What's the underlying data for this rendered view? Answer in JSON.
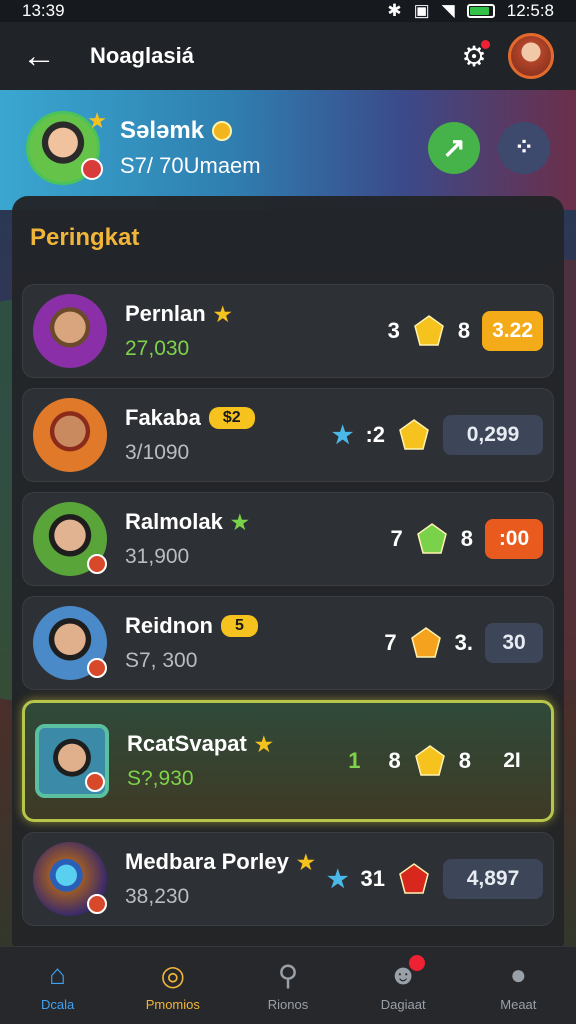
{
  "status": {
    "time": "13:39",
    "right_time": "12:5:8"
  },
  "app_bar": {
    "title": "Noaglasiá"
  },
  "profile": {
    "name": "Sələmk",
    "score": "S7/ 70Umaem"
  },
  "panel": {
    "title": "Peringkat"
  },
  "players": [
    {
      "name": "Pernlan",
      "score": "27,030",
      "left_num": "3",
      "right_num": "8",
      "value": "3.22",
      "gem_color": "#f5c21e",
      "val_style": "yellow",
      "score_style": "green",
      "tag": ""
    },
    {
      "name": "Fakaba",
      "score": "3/1090",
      "left_num": ":2",
      "right_num": "",
      "value": "0,299",
      "gem_color": "#f5c21e",
      "val_style": "slate",
      "score_style": "",
      "tag": "$2"
    },
    {
      "name": "Ralmolak",
      "score": "31,900",
      "left_num": "7",
      "right_num": "8",
      "value": ":00",
      "gem_color": "#7ad24a",
      "val_style": "orange",
      "score_style": "",
      "tag": ""
    },
    {
      "name": "Reidnon",
      "score": "S7, 300",
      "left_num": "7",
      "right_num": "3.",
      "value": "30",
      "gem_color": "#f5a21e",
      "val_style": "dark",
      "score_style": "",
      "tag": "5"
    },
    {
      "name": "RcatSvapat",
      "score": "S?,930",
      "rank": "1",
      "left_num": "8",
      "right_num": "8",
      "value": "2I",
      "gem_color": "#f5c21e",
      "val_style": "plain",
      "score_style": "green",
      "tag": ""
    },
    {
      "name": "Medbara Porley",
      "score": "38,230",
      "left_num": "31",
      "right_num": "",
      "value": "4,897",
      "gem_color": "#d8281e",
      "val_style": "slate",
      "score_style": "",
      "tag": ""
    }
  ],
  "nav": [
    {
      "label": "Dcala",
      "icon": "⌂"
    },
    {
      "label": "Pmomios",
      "icon": "◎"
    },
    {
      "label": "Rionos",
      "icon": "⚲"
    },
    {
      "label": "Dagiaat",
      "icon": "☻"
    },
    {
      "label": "Meaat",
      "icon": "●"
    }
  ]
}
